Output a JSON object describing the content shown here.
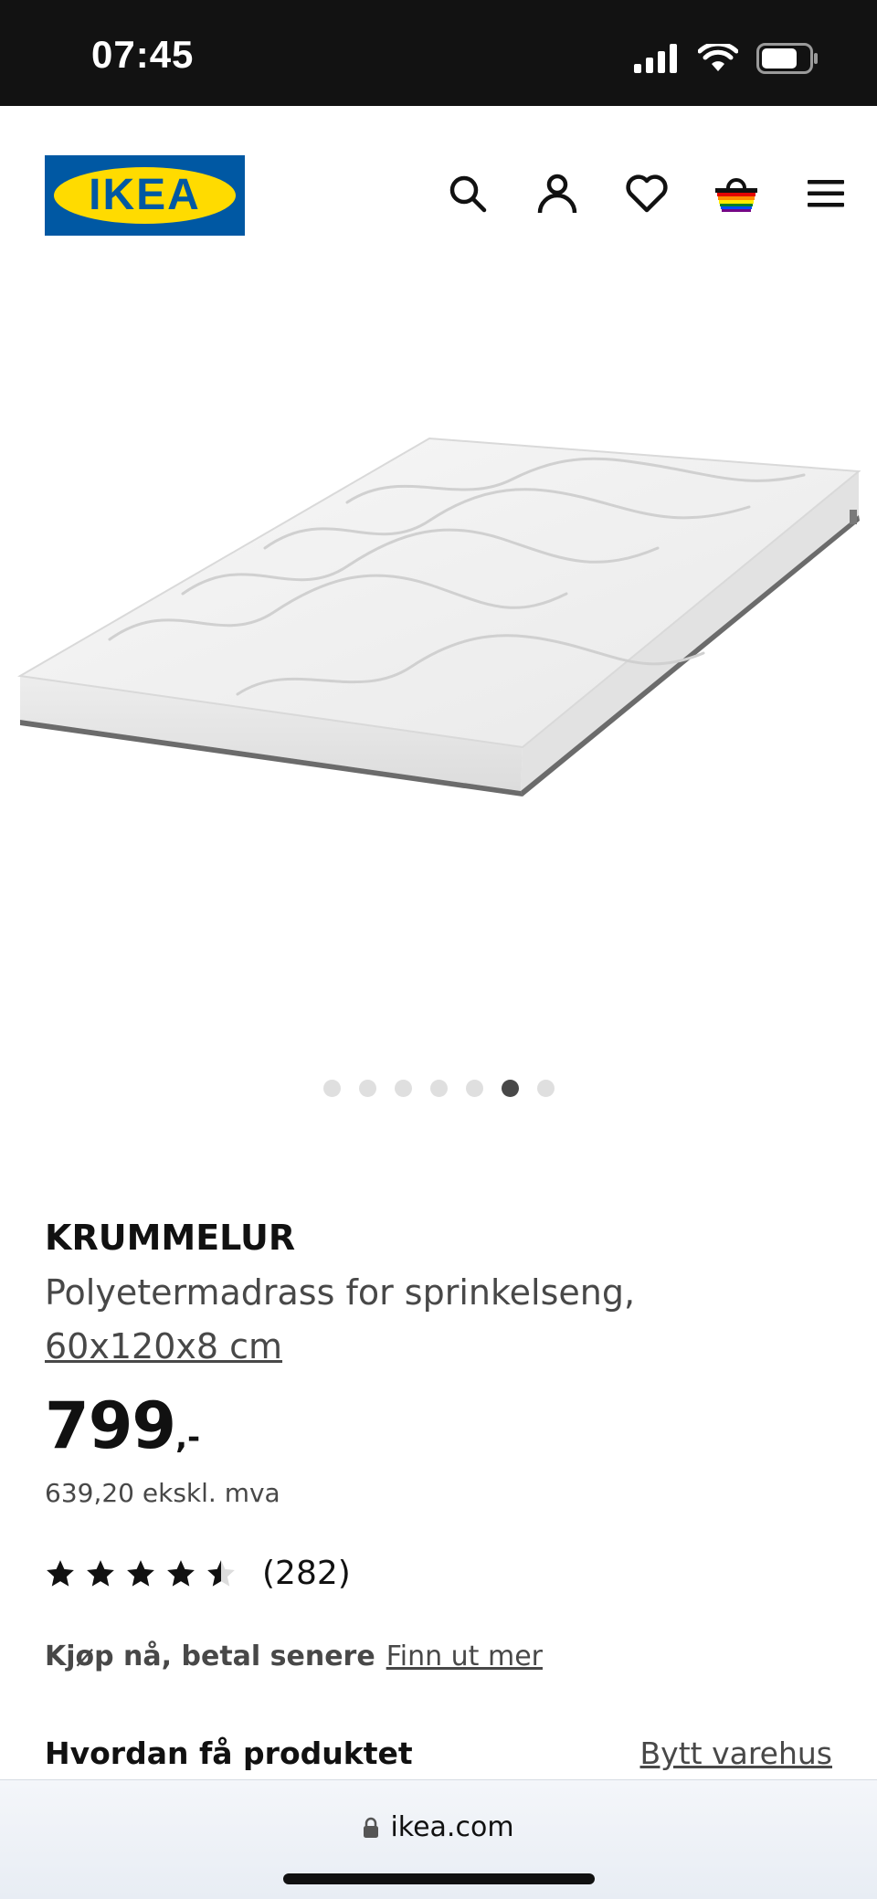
{
  "status_bar": {
    "time": "07:45",
    "battery_level": 0.75
  },
  "header": {
    "logo_text": "IKEA",
    "icons": [
      "search-icon",
      "account-icon",
      "heart-icon",
      "cart-icon",
      "menu-icon"
    ]
  },
  "gallery": {
    "image_count": 7,
    "active_index": 5
  },
  "product": {
    "name": "KRUMMELUR",
    "description": "Polyetermadrass for sprinkelseng,",
    "size": "60x120x8 cm",
    "price": "799",
    "price_suffix": ",-",
    "price_ex_vat": "639,20 ekskl. mva",
    "rating_value": 4.5,
    "rating_max": 5,
    "review_count": "(282)"
  },
  "paylater": {
    "label": "Kjøp nå, betal senere",
    "link": "Finn ut mer"
  },
  "delivery": {
    "title": "Hvordan få produktet",
    "change_store": "Bytt varehus"
  },
  "browser": {
    "url": "ikea.com"
  },
  "colors": {
    "ikea_blue": "#0058a3",
    "ikea_yellow": "#ffdb00",
    "text_dark": "#111111",
    "text_grey": "#484848"
  }
}
